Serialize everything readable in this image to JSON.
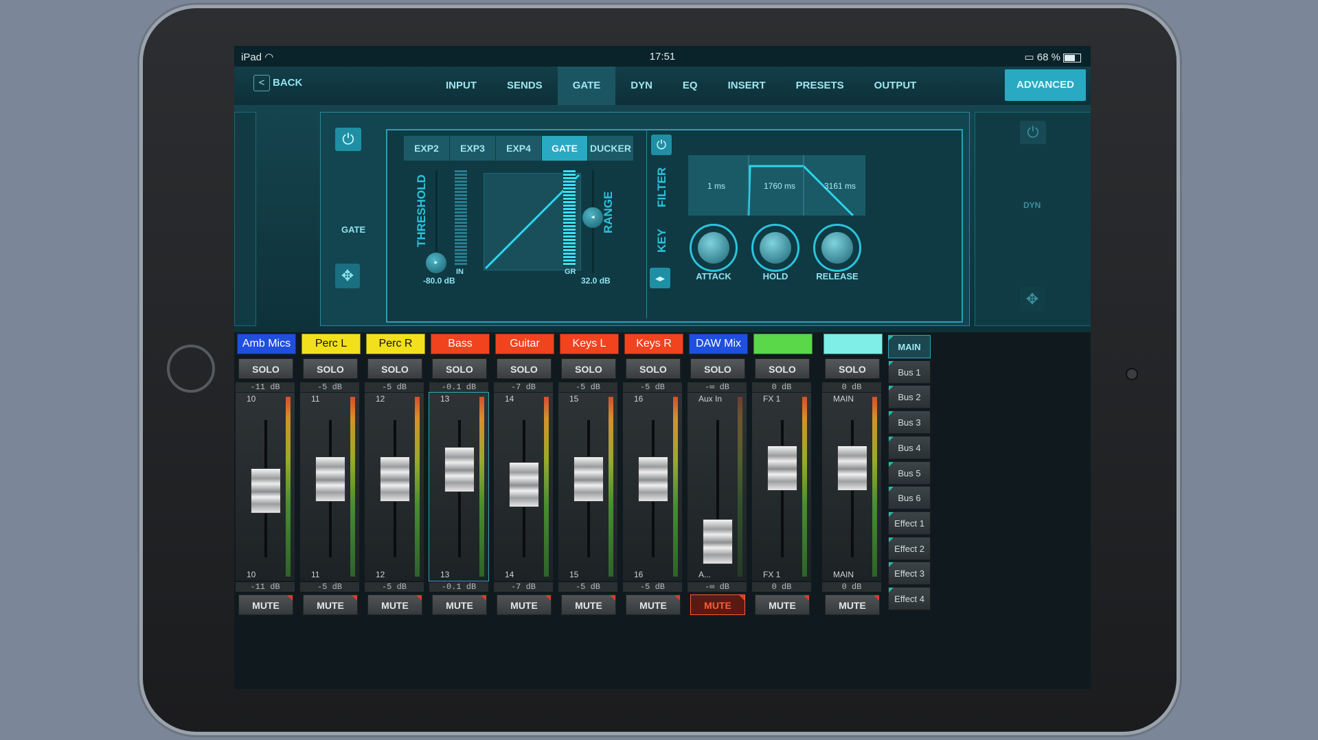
{
  "status": {
    "device": "iPad",
    "wifi_icon": "wifi-icon",
    "time": "17:51",
    "battery": "68 %"
  },
  "nav": {
    "back": "BACK",
    "tabs": [
      "INPUT",
      "SENDS",
      "GATE",
      "DYN",
      "EQ",
      "INSERT",
      "PRESETS",
      "OUTPUT"
    ],
    "active_tab": "GATE",
    "advanced": "ADVANCED"
  },
  "gate": {
    "label": "GATE",
    "modes": [
      "EXP2",
      "EXP3",
      "EXP4",
      "GATE",
      "DUCKER"
    ],
    "active_mode": "GATE",
    "threshold_label": "THRESHOLD",
    "threshold_value": "-80.0 dB",
    "range_label": "RANGE",
    "range_value": "32.0 dB",
    "in_label": "IN",
    "gr_label": "GR",
    "filter_label": "FILTER",
    "key_label": "KEY",
    "attack_time": "1 ms",
    "hold_time": "1760 ms",
    "release_time": "3161 ms",
    "knobs": [
      "ATTACK",
      "HOLD",
      "RELEASE"
    ],
    "right_label": "DYN"
  },
  "channels": [
    {
      "name": "Amb Mics R",
      "color": "#1e4fe0",
      "text_color": "#ffffff",
      "db_top": "-11 dB",
      "db_bot": "-11 dB",
      "num_top": "10",
      "num_bot": "10",
      "solo": "SOLO",
      "mute": "MUTE",
      "level": 0.55
    },
    {
      "name": "Perc L",
      "color": "#f2e01c",
      "text_color": "#111111",
      "db_top": "-5 dB",
      "db_bot": "-5 dB",
      "num_top": "11",
      "num_bot": "11",
      "solo": "SOLO",
      "mute": "MUTE",
      "level": 0.68
    },
    {
      "name": "Perc R",
      "color": "#f2e01c",
      "text_color": "#111111",
      "db_top": "-5 dB",
      "db_bot": "-5 dB",
      "num_top": "12",
      "num_bot": "12",
      "solo": "SOLO",
      "mute": "MUTE",
      "level": 0.68
    },
    {
      "name": "Bass",
      "color": "#f0431e",
      "text_color": "#ffffff",
      "db_top": "-0.1 dB",
      "db_bot": "-0.1 dB",
      "num_top": "13",
      "num_bot": "13",
      "solo": "SOLO",
      "mute": "MUTE",
      "level": 0.78
    },
    {
      "name": "Guitar",
      "color": "#f0431e",
      "text_color": "#ffffff",
      "db_top": "-7 dB",
      "db_bot": "-7 dB",
      "num_top": "14",
      "num_bot": "14",
      "solo": "SOLO",
      "mute": "MUTE",
      "level": 0.62
    },
    {
      "name": "Keys L",
      "color": "#f0431e",
      "text_color": "#ffffff",
      "db_top": "-5 dB",
      "db_bot": "-5 dB",
      "num_top": "15",
      "num_bot": "15",
      "solo": "SOLO",
      "mute": "MUTE",
      "level": 0.68
    },
    {
      "name": "Keys R",
      "color": "#f0431e",
      "text_color": "#ffffff",
      "db_top": "-5 dB",
      "db_bot": "-5 dB",
      "num_top": "16",
      "num_bot": "16",
      "solo": "SOLO",
      "mute": "MUTE",
      "level": 0.68
    },
    {
      "name": "DAW Mix",
      "color": "#1e4fe0",
      "text_color": "#ffffff",
      "db_top": "-∞ dB",
      "db_bot": "-∞ dB",
      "num_top": "Aux In",
      "num_bot": "A...",
      "solo": "SOLO",
      "mute": "MUTE",
      "level": 0.0,
      "muted": true
    },
    {
      "name": "",
      "color": "#5ad84a",
      "text_color": "#ffffff",
      "db_top": "0 dB",
      "db_bot": "0 dB",
      "num_top": "FX 1",
      "num_bot": "FX 1",
      "solo": "SOLO",
      "mute": "MUTE",
      "level": 0.8
    }
  ],
  "main_channel": {
    "name": "",
    "color": "#7eeee6",
    "db_top": "0 dB",
    "db_bot": "0 dB",
    "num_top": "MAIN",
    "num_bot": "MAIN",
    "solo": "SOLO",
    "mute": "MUTE",
    "level": 0.8
  },
  "buses": [
    "MAIN",
    "Bus 1",
    "Bus 2",
    "Bus 3",
    "Bus 4",
    "Bus 5",
    "Bus 6",
    "Effect 1",
    "Effect 2",
    "Effect 3",
    "Effect 4"
  ]
}
